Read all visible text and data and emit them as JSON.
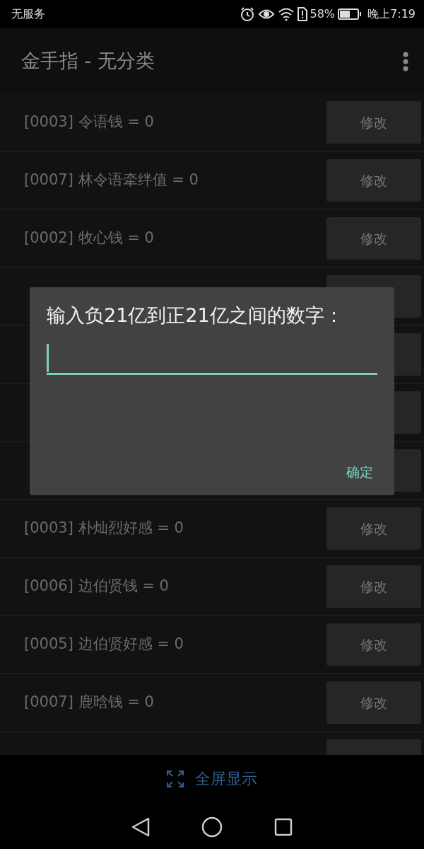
{
  "status_bar": {
    "carrier": "无服务",
    "battery": "58%",
    "time": "晚上7:19"
  },
  "app_bar": {
    "title": "金手指 - 无分类"
  },
  "rows": [
    {
      "kind": "item",
      "label": "[0003] 令语钱 = 0",
      "button": "修改"
    },
    {
      "kind": "item",
      "label": "[0007] 林令语牵绊值 = 0",
      "button": "修改"
    },
    {
      "kind": "item",
      "label": "[0002] 牧心钱 = 0",
      "button": "修改"
    },
    {
      "kind": "hidden"
    },
    {
      "kind": "hidden"
    },
    {
      "kind": "hidden"
    },
    {
      "kind": "hidden"
    },
    {
      "kind": "item",
      "label": "[0003] 朴灿烈好感 = 0",
      "button": "修改"
    },
    {
      "kind": "item",
      "label": "[0006] 边伯贤钱 = 0",
      "button": "修改"
    },
    {
      "kind": "item",
      "label": "[0005] 边伯贤好感 = 0",
      "button": "修改"
    },
    {
      "kind": "item",
      "label": "[0007] 鹿晗钱 = 0",
      "button": "修改"
    },
    {
      "kind": "hidden"
    }
  ],
  "dialog": {
    "message": "输入负21亿到正21亿之间的数字：",
    "field": {
      "focused": true
    },
    "ok_button": "确定"
  },
  "fullscreen_button": "全屏显示"
}
